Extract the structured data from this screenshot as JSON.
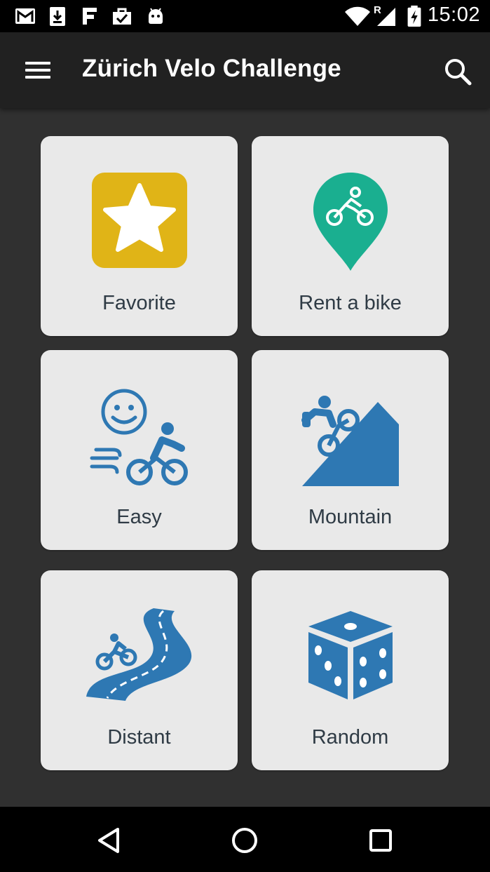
{
  "status_bar": {
    "time": "15:02",
    "roaming_indicator": "R",
    "icons": [
      "gmail-icon",
      "download-icon",
      "app-notification-icon",
      "task-icon",
      "android-icon",
      "wifi-icon",
      "cell-signal-icon",
      "battery-charging-icon"
    ]
  },
  "app_bar": {
    "title": "Zürich Velo Challenge",
    "menu_icon": "hamburger-menu-icon",
    "search_icon": "search-icon"
  },
  "tiles": [
    {
      "label": "Favorite",
      "icon": "star-icon",
      "color": "#e0b417"
    },
    {
      "label": "Rent a bike",
      "icon": "bike-location-pin-icon",
      "color": "#1aaf90"
    },
    {
      "label": "Easy",
      "icon": "easy-ride-icon",
      "color": "#2e78b3"
    },
    {
      "label": "Mountain",
      "icon": "mountain-bike-icon",
      "color": "#2e78b3"
    },
    {
      "label": "Distant",
      "icon": "distant-road-icon",
      "color": "#2e78b3"
    },
    {
      "label": "Random",
      "icon": "dice-icon",
      "color": "#2e78b3"
    }
  ],
  "nav_bar": {
    "icons": [
      "back-icon",
      "home-icon",
      "recents-icon"
    ]
  }
}
